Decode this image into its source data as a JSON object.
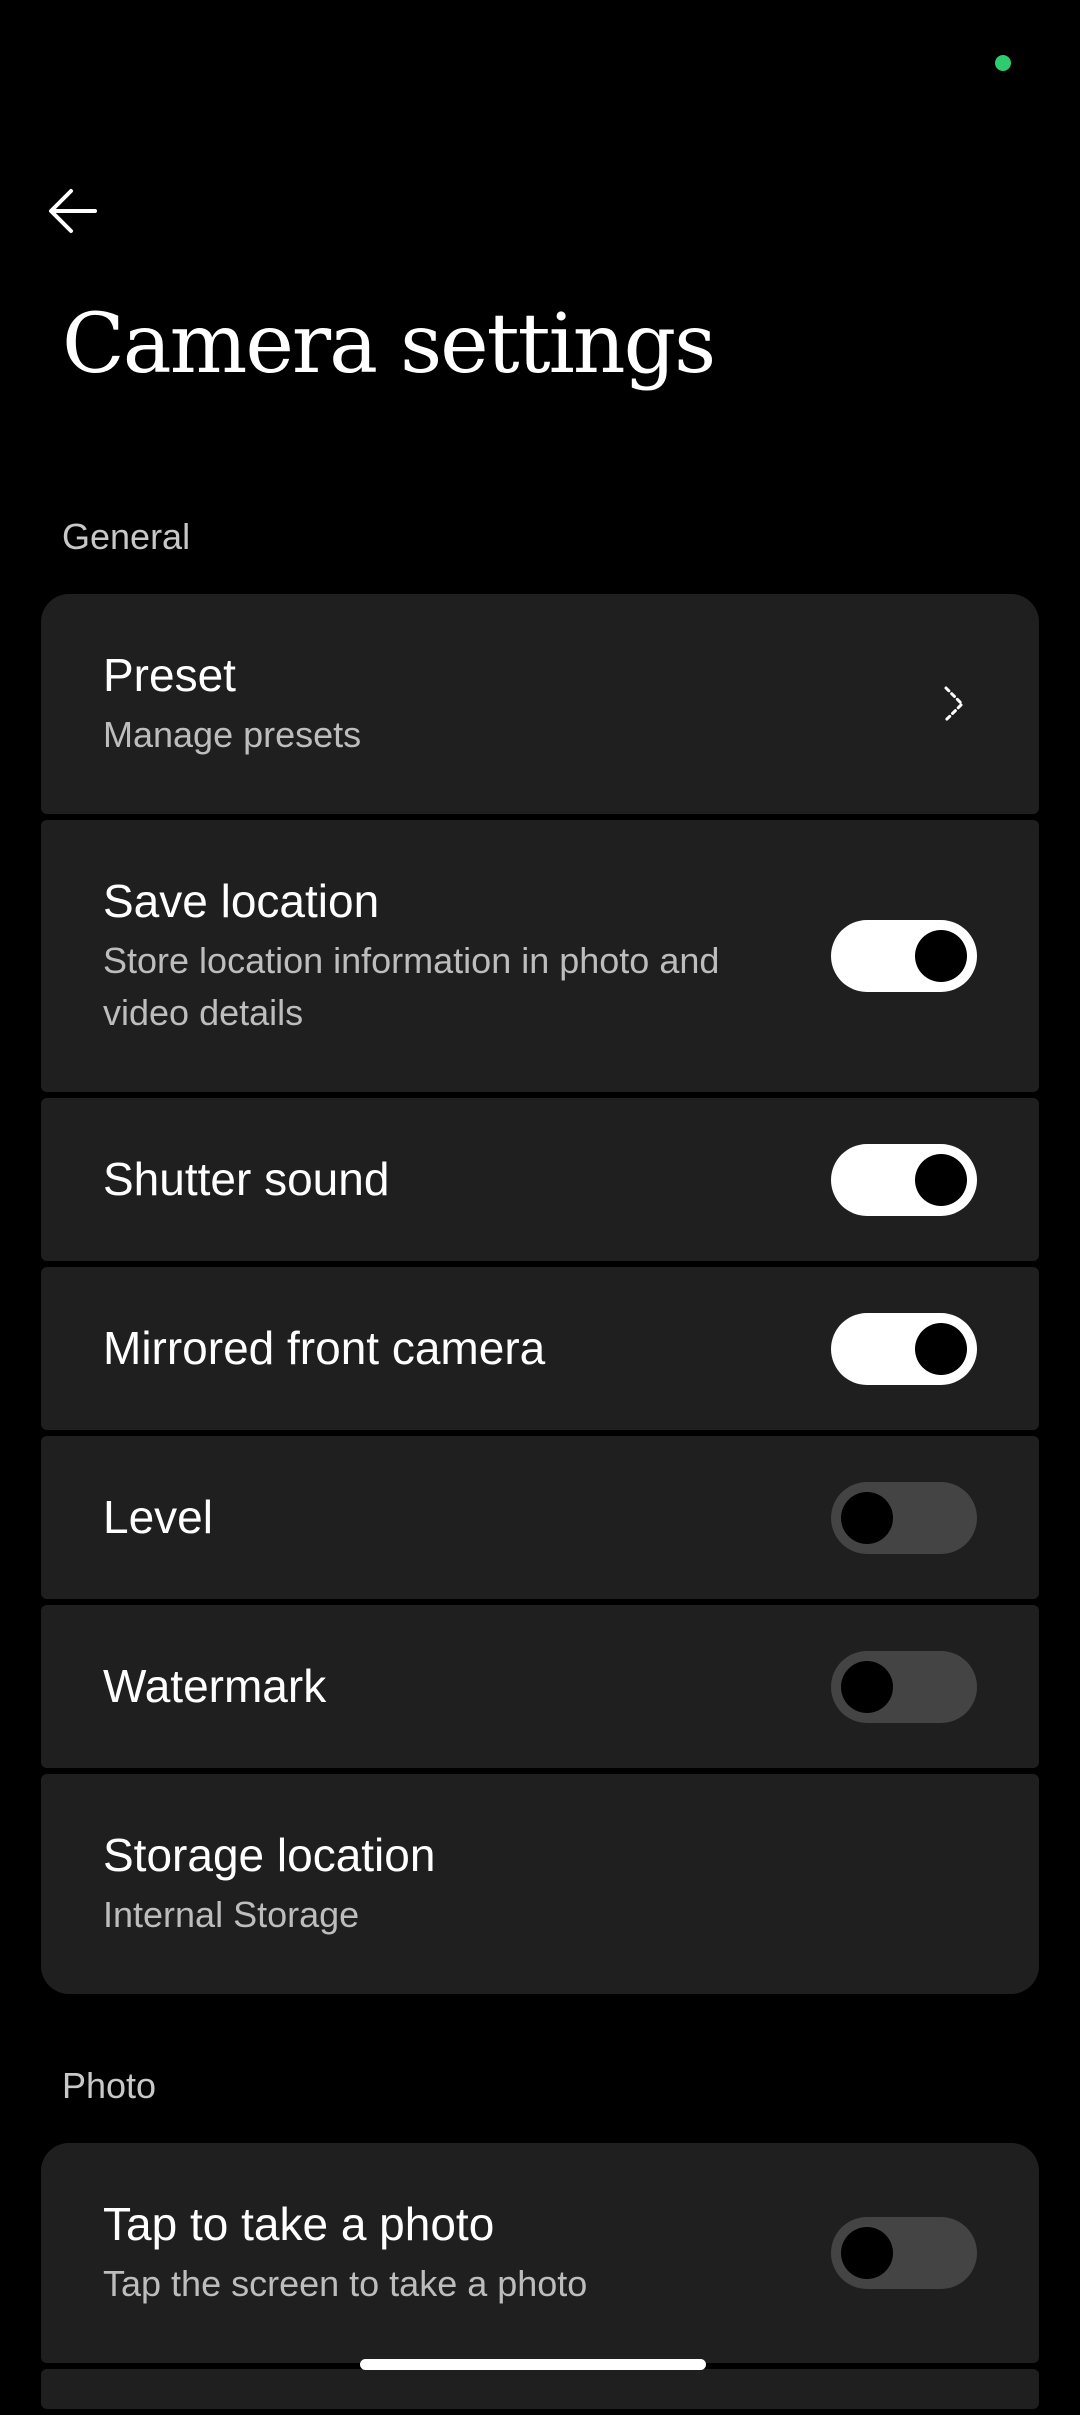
{
  "header": {
    "title": "Camera settings"
  },
  "sections": {
    "general": {
      "label": "General",
      "preset": {
        "title": "Preset",
        "subtitle": "Manage presets"
      },
      "save_location": {
        "title": "Save location",
        "subtitle": "Store location information in photo and video details",
        "enabled": true
      },
      "shutter_sound": {
        "title": "Shutter sound",
        "enabled": true
      },
      "mirrored_front_camera": {
        "title": "Mirrored front camera",
        "enabled": true
      },
      "level": {
        "title": "Level",
        "enabled": false
      },
      "watermark": {
        "title": "Watermark",
        "enabled": false
      },
      "storage_location": {
        "title": "Storage location",
        "subtitle": "Internal Storage"
      }
    },
    "photo": {
      "label": "Photo",
      "tap_to_take_photo": {
        "title": "Tap to take a photo",
        "subtitle": "Tap the screen to take a photo",
        "enabled": false
      }
    }
  },
  "icons": {
    "back": "arrow-left-icon",
    "preset_chevron": "chevron-right-icon"
  },
  "colors": {
    "background": "#000000",
    "card": "#1f1f1f",
    "status_dot": "#2ecc71",
    "toggle_on": "#ffffff",
    "toggle_off": "#444444"
  }
}
